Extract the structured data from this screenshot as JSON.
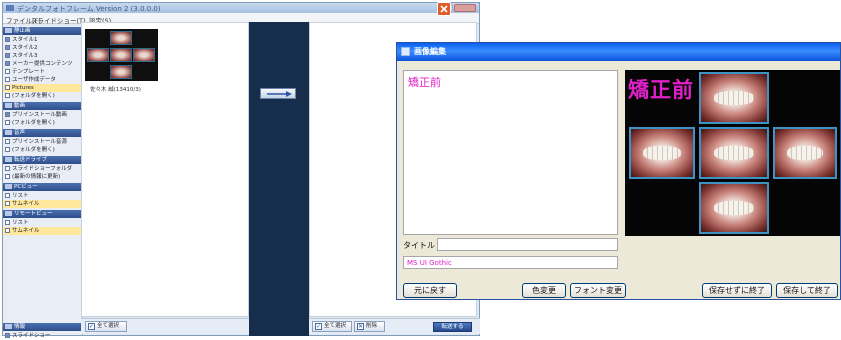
{
  "main_window": {
    "title": "デンタルフォトフレーム Version 2 (3.0.0.0)",
    "menu": [
      "ファイル(F)",
      "スライドショー(T)",
      "設定(S)"
    ]
  },
  "sidebar": {
    "sections": [
      {
        "header": "静止画",
        "items": [
          {
            "label": "スタイル1"
          },
          {
            "label": "スタイル2"
          },
          {
            "label": "スタイル3"
          },
          {
            "label": "メーカー提供コンテンツ"
          },
          {
            "label": "テンプレート"
          },
          {
            "label": "ユーザ作成データ"
          },
          {
            "label": "Pictures",
            "selected": true
          },
          {
            "label": "(フォルダを開く)"
          }
        ]
      },
      {
        "header": "動画",
        "items": [
          {
            "label": "プリインストール動画"
          },
          {
            "label": "(フォルダを開く)"
          }
        ]
      },
      {
        "header": "音声",
        "items": [
          {
            "label": "プリインストール音源"
          },
          {
            "label": "(フォルダを開く)"
          }
        ]
      },
      {
        "header": "転送ドライブ",
        "items": [
          {
            "label": "スライドショーフォルダ"
          },
          {
            "label": "(最新の情報に更新)"
          }
        ]
      },
      {
        "header": "PCビュー",
        "items": [
          {
            "label": "リスト"
          },
          {
            "label": "サムネイル",
            "selected": true
          }
        ]
      },
      {
        "header": "リモートビュー",
        "items": [
          {
            "label": "リスト"
          },
          {
            "label": "サムネイル",
            "selected": true
          }
        ]
      }
    ],
    "footer": {
      "header": "情報",
      "item": "スライドショー"
    }
  },
  "left_pane": {
    "thumbnail_caption": "佐々木 誠(13410/3)"
  },
  "bottom_left": {
    "select_all": "全て選択"
  },
  "bottom_right": {
    "select_all": "全て選択",
    "delete": "削除",
    "transfer": "転送する"
  },
  "dialog": {
    "title": "画像編集",
    "text_content": "矯正前",
    "title_label": "タイトル",
    "title_value": "",
    "font_name": "MS UI Gothic",
    "buttons": {
      "revert": "元に戻す",
      "color": "色変更",
      "font": "フォント変更",
      "close_nosave": "保存せずに終了",
      "save_close": "保存して終了"
    },
    "preview_text": "矯正前"
  },
  "colors": {
    "accent_text": "#e020c8",
    "dialog_title": "#0a5ff0",
    "center_band": "#172d4c"
  }
}
